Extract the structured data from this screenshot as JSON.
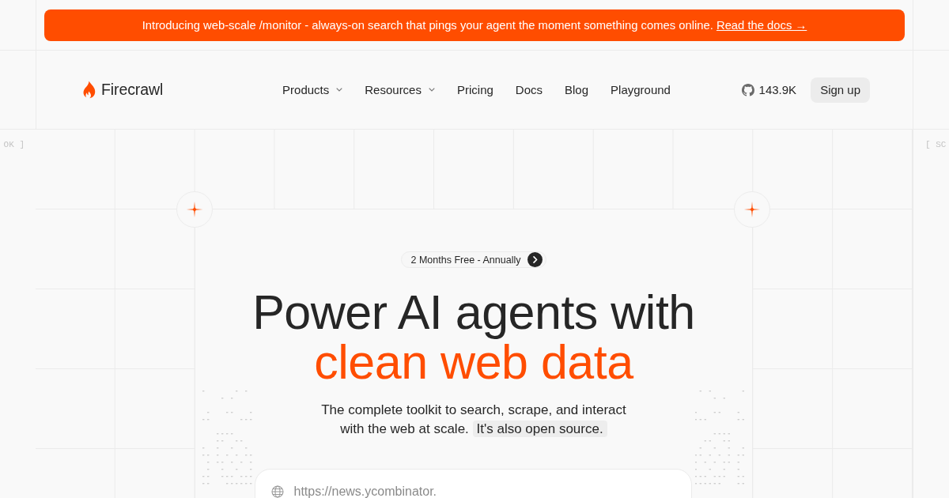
{
  "announcement": {
    "text": "Introducing web-scale /monitor - always-on search that pings your agent the moment something comes online.",
    "link": "Read the docs →"
  },
  "side_labels": {
    "left": "OK ]",
    "right": "[ SC"
  },
  "nav": {
    "logo": "Firecrawl",
    "items": [
      {
        "label": "Products",
        "kind": "dropdown"
      },
      {
        "label": "Resources",
        "kind": "dropdown"
      },
      {
        "label": "Pricing",
        "kind": "link"
      },
      {
        "label": "Docs",
        "kind": "link"
      },
      {
        "label": "Blog",
        "kind": "link"
      },
      {
        "label": "Playground",
        "kind": "link"
      }
    ],
    "github_stars": "143.9K",
    "signup": "Sign up"
  },
  "hero": {
    "badge": "2 Months Free - Annually",
    "headline": "Power AI agents with",
    "headline_accent": "clean web data",
    "subtitle": "The complete toolkit to search, scrape, and interact with the web at scale.",
    "subtitle_tag": "It's also open source.",
    "url_field": {
      "placeholder": "https://news.ycombinator."
    }
  }
}
